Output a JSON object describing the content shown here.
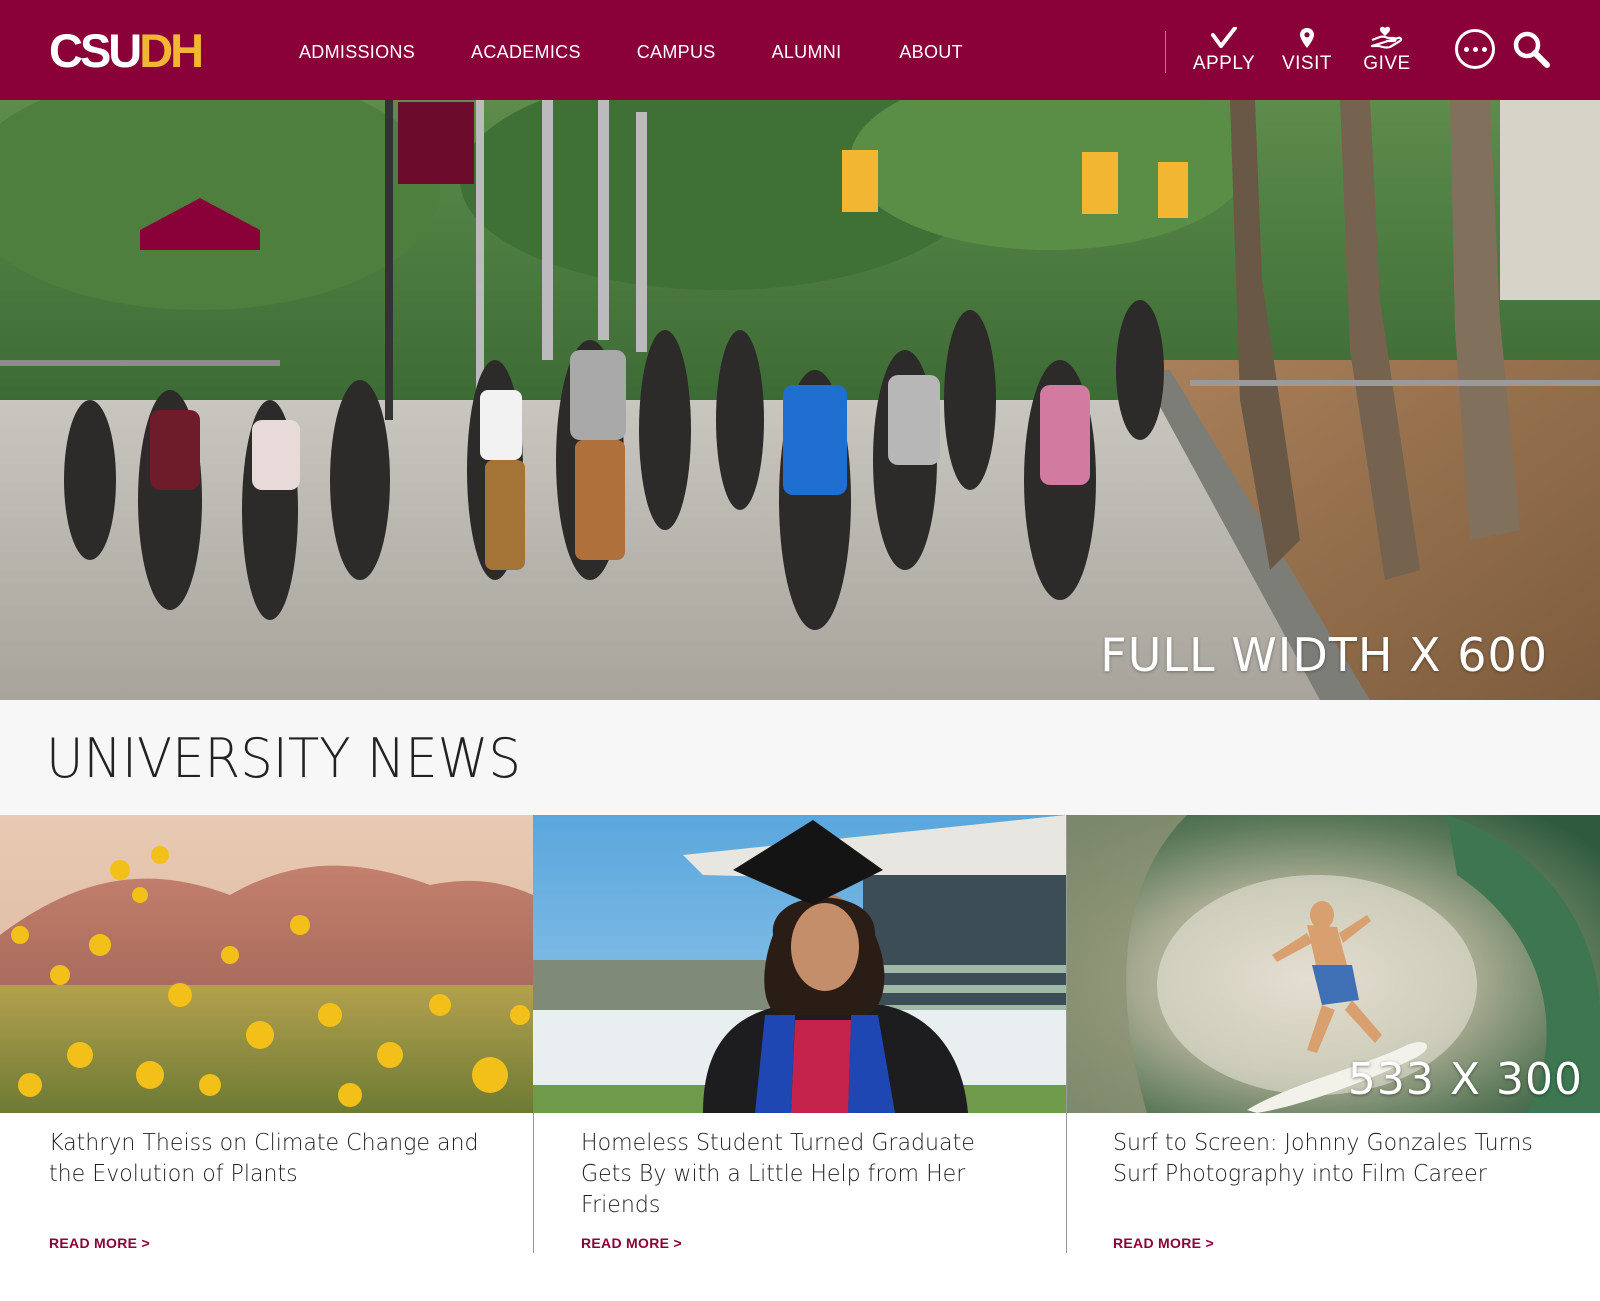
{
  "header": {
    "logo": {
      "part1": "CSU",
      "part2": "DH"
    },
    "nav": [
      "ADMISSIONS",
      "ACADEMICS",
      "CAMPUS",
      "ALUMNI",
      "ABOUT"
    ],
    "actions": {
      "apply": "APPLY",
      "visit": "VISIT",
      "give": "GIVE"
    },
    "brand_color": "#8a0038",
    "accent_color": "#f2b632",
    "icons": [
      "checkmark-icon",
      "map-pin-icon",
      "hand-heart-icon",
      "more-icon",
      "search-icon"
    ]
  },
  "hero": {
    "caption": "FULL WIDTH X 600"
  },
  "news": {
    "title": "UNIVERSITY NEWS",
    "cards": [
      {
        "headline": "Kathryn Theiss on Climate Change and the Evolution of Plants",
        "link": "READ MORE >",
        "image_caption": ""
      },
      {
        "headline": "Homeless Student Turned Graduate Gets By with a Little Help from Her Friends",
        "link": "READ MORE >",
        "image_caption": ""
      },
      {
        "headline": "Surf to Screen: Johnny Gonzales Turns Surf Photography into Film Career",
        "link": "READ MORE >",
        "image_caption": "533 X 300"
      }
    ]
  }
}
